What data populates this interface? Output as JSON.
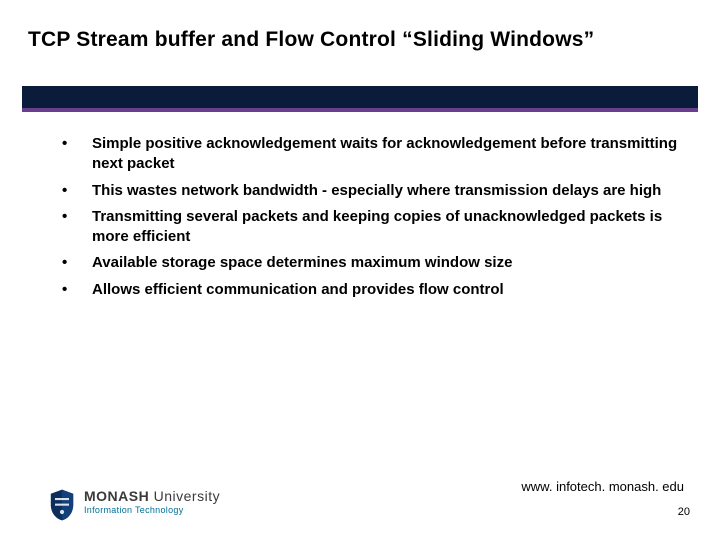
{
  "title": "TCP Stream buffer and Flow Control “Sliding Windows”",
  "bullets": [
    "Simple positive acknowledgement waits for acknowledgement before transmitting next packet",
    "This wastes network bandwidth - especially where transmission delays are high",
    "Transmitting several packets and keeping copies of unacknowledged packets is more efficient",
    "Available storage space determines maximum window size",
    "Allows efficient communication and provides flow control"
  ],
  "footer": {
    "url": "www. infotech. monash. edu",
    "page": "20",
    "logo_main_bold": "MONASH",
    "logo_main_light": " University",
    "logo_sub": "Information Technology"
  }
}
